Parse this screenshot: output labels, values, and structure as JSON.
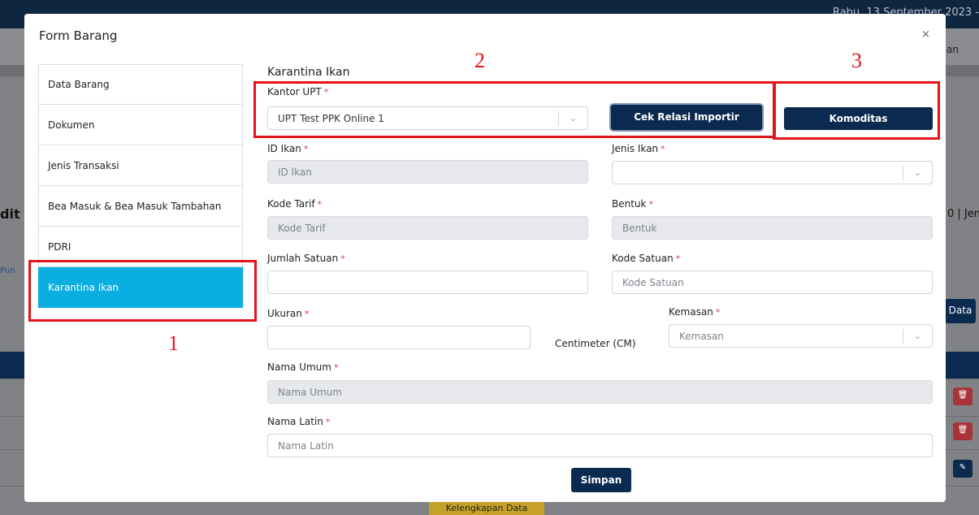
{
  "background": {
    "date_text": "Rabu, 13 September 2023 -",
    "tab_right_partial": "an",
    "left_title_partial": "dit",
    "left_link_partial": "Pun",
    "right_text_partial": "0 | Jeni",
    "data_button_partial": "Data",
    "footer_label": "Kelengkapan Data"
  },
  "modal": {
    "title": "Form Barang",
    "close_label": "×",
    "nav_items": [
      {
        "label": "Data Barang",
        "active": false
      },
      {
        "label": "Dokumen",
        "active": false
      },
      {
        "label": "Jenis Transaksi",
        "active": false
      },
      {
        "label": "Bea Masuk & Bea Masuk Tambahan",
        "active": false
      },
      {
        "label": "PDRI",
        "active": false
      },
      {
        "label": "Karantina Ikan",
        "active": true
      }
    ],
    "section_title": "Karantina Ikan",
    "form": {
      "kantor_upt": {
        "label": "Kantor UPT",
        "value": "UPT Test PPK Online 1"
      },
      "cek_relasi_button": "Cek Relasi Importir",
      "komoditas_button": "Komoditas",
      "id_ikan": {
        "label": "ID Ikan",
        "placeholder": "ID Ikan"
      },
      "jenis_ikan": {
        "label": "Jenis Ikan",
        "value": ""
      },
      "kode_tarif": {
        "label": "Kode Tarif",
        "placeholder": "Kode Tarif"
      },
      "bentuk": {
        "label": "Bentuk",
        "placeholder": "Bentuk"
      },
      "jumlah_satuan": {
        "label": "Jumlah Satuan",
        "value": ""
      },
      "kode_satuan": {
        "label": "Kode Satuan",
        "placeholder": "Kode Satuan"
      },
      "ukuran": {
        "label": "Ukuran",
        "value": "",
        "unit": "Centimeter (CM)"
      },
      "kemasan": {
        "label": "Kemasan",
        "placeholder": "Kemasan"
      },
      "nama_umum": {
        "label": "Nama Umum",
        "placeholder": "Nama Umum"
      },
      "nama_latin": {
        "label": "Nama Latin",
        "placeholder": "Nama Latin"
      },
      "required_mark": "*",
      "submit_button": "Simpan"
    }
  },
  "annotations": [
    "1",
    "2",
    "3"
  ],
  "colors": {
    "navy": "#0b2a4f",
    "active_tab": "#0aaee0",
    "annotation_red": "#e4141b",
    "required_red": "#e03a3a"
  }
}
